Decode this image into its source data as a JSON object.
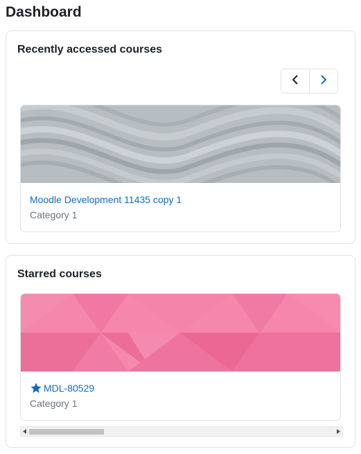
{
  "page": {
    "title": "Dashboard"
  },
  "recent": {
    "title": "Recently accessed courses",
    "prev_icon": "chevron-left-icon",
    "next_icon": "chevron-right-icon",
    "course": {
      "name": "Moodle Development 11435 copy 1",
      "category": "Category 1",
      "image": "grey-wave-pattern"
    }
  },
  "starred": {
    "title": "Starred courses",
    "course": {
      "name": "MDL-80529",
      "category": "Category 1",
      "image": "pink-triangle-pattern",
      "star_icon": "star-icon"
    }
  },
  "colors": {
    "link": "#0f6cbf",
    "muted": "#6a737b",
    "border": "#dee2e6",
    "pink": "#f07fa6",
    "grey": "#b9c0c4"
  }
}
